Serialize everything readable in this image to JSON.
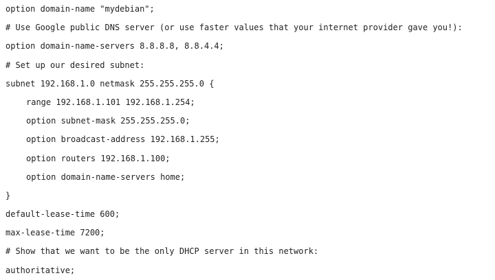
{
  "code": {
    "lines": [
      "option domain-name \"mydebian\";",
      "# Use Google public DNS server (or use faster values that your internet provider gave you!):",
      "option domain-name-servers 8.8.8.8, 8.8.4.4;",
      "# Set up our desired subnet:",
      "subnet 192.168.1.0 netmask 255.255.255.0 {",
      "range 192.168.1.101 192.168.1.254;",
      "option subnet-mask 255.255.255.0;",
      "option broadcast-address 192.168.1.255;",
      "option routers 192.168.1.100;",
      "option domain-name-servers home;",
      "}",
      "default-lease-time 600;",
      "max-lease-time 7200;",
      "# Show that we want to be the only DHCP server in this network:",
      "authoritative;"
    ]
  }
}
